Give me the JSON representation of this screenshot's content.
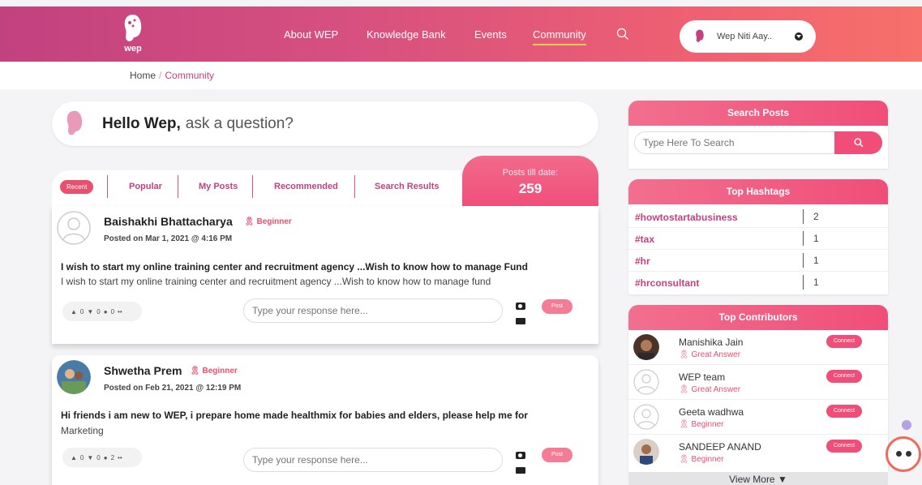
{
  "header": {
    "logo_text": "wep",
    "nav": [
      {
        "label": "About WEP"
      },
      {
        "label": "Knowledge Bank"
      },
      {
        "label": "Events"
      },
      {
        "label": "Community"
      }
    ],
    "user_name": "Wep Niti Aay.."
  },
  "breadcrumb": {
    "home": "Home",
    "separator": "/",
    "current": "Community"
  },
  "ask": {
    "greeting": "Hello Wep,",
    "prompt": "ask a question?"
  },
  "tabs": [
    "Recent",
    "Popular",
    "My Posts",
    "Recommended",
    "Search Results"
  ],
  "posts_count": {
    "label": "Posts till date:",
    "value": "259"
  },
  "posts": [
    {
      "author": "Baishakhi Bhattacharya",
      "badge": "Beginner",
      "date": "Posted on Mar 1, 2021 @ 4:16 PM",
      "title": "I wish to start my online training center and recruitment agency ...Wish to know how to manage Fund",
      "body": "I wish to start my online training center and recruitment agency ...Wish to know how to manage fund",
      "reactions": {
        "up": "0",
        "down": "0",
        "comments": "0",
        "more": "••"
      },
      "response_placeholder": "Type your response here...",
      "post_label": "Post"
    },
    {
      "author": "Shwetha Prem",
      "badge": "Beginner",
      "date": "Posted on Feb 21, 2021 @ 12:19 PM",
      "title": "Hi friends i am new to WEP, i prepare home made healthmix for babies and elders, please help me for",
      "body": "Marketing",
      "reactions": {
        "up": "0",
        "down": "0",
        "comments": "2",
        "more": "••"
      },
      "response_placeholder": "Type your response here...",
      "post_label": "Post"
    }
  ],
  "search_posts": {
    "title": "Search Posts",
    "placeholder": "Type Here To Search"
  },
  "top_hashtags": {
    "title": "Top Hashtags",
    "items": [
      {
        "tag": "#howtostartabusiness",
        "count": "2"
      },
      {
        "tag": "#tax",
        "count": "1"
      },
      {
        "tag": "#hr",
        "count": "1"
      },
      {
        "tag": "#hrconsultant",
        "count": "1"
      }
    ]
  },
  "top_contributors": {
    "title": "Top Contributors",
    "connect_label": "Connect",
    "items": [
      {
        "name": "Manishika Jain",
        "badge": "Great Answer"
      },
      {
        "name": "WEP team",
        "badge": "Great Answer"
      },
      {
        "name": "Geeta wadhwa",
        "badge": "Beginner"
      },
      {
        "name": "SANDEEP ANAND",
        "badge": "Beginner"
      }
    ],
    "view_more": "View More"
  },
  "colors": {
    "brand": "#c2417f",
    "accent": "#f04e78",
    "header_end": "#f7706a"
  }
}
